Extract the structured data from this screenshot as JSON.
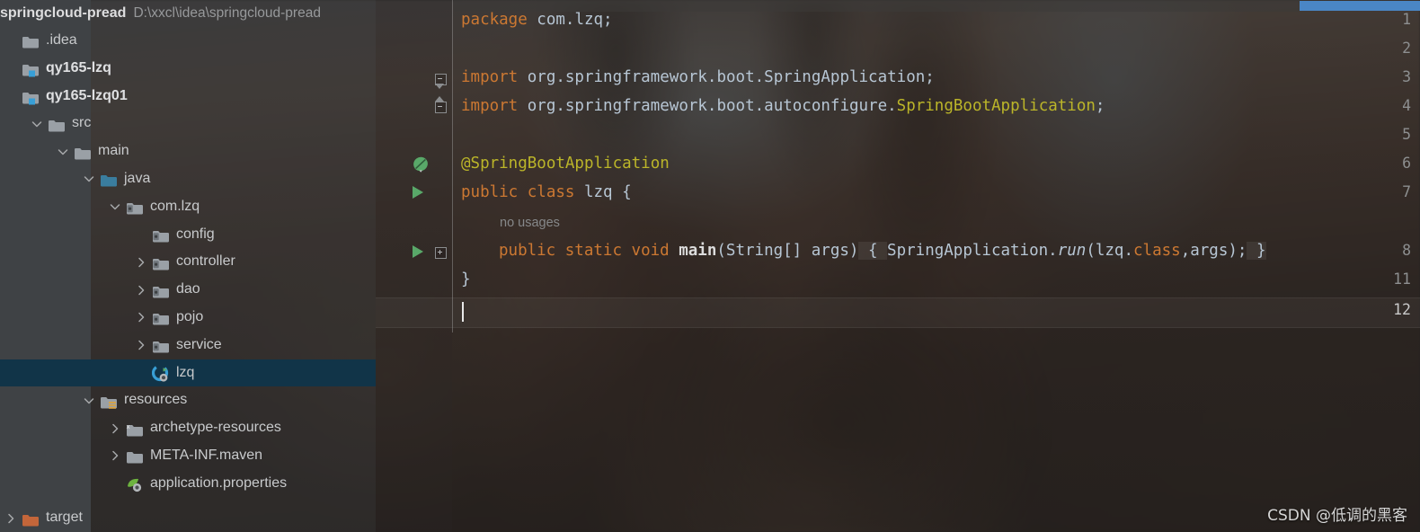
{
  "project": {
    "name": "springcloud-pread",
    "path": "D:\\xxcl\\idea\\springcloud-pread"
  },
  "tree": {
    "items": [
      {
        "label": ".idea",
        "icon": "folder-icon",
        "indent": 0,
        "arrow": "none",
        "bold": false,
        "selected": false
      },
      {
        "label": "qy165-lzq",
        "icon": "module-folder-icon",
        "indent": 0,
        "arrow": "none",
        "bold": true,
        "selected": false
      },
      {
        "label": "qy165-lzq01",
        "icon": "module-folder-icon",
        "indent": 0,
        "arrow": "none",
        "bold": true,
        "selected": false
      },
      {
        "label": "src",
        "icon": "folder-icon",
        "indent": 1,
        "arrow": "expanded",
        "bold": false,
        "selected": false
      },
      {
        "label": "main",
        "icon": "folder-icon",
        "indent": 2,
        "arrow": "expanded",
        "bold": false,
        "selected": false
      },
      {
        "label": "java",
        "icon": "source-root-folder-icon",
        "indent": 3,
        "arrow": "expanded",
        "bold": false,
        "selected": false
      },
      {
        "label": "com.lzq",
        "icon": "package-icon",
        "indent": 4,
        "arrow": "expanded",
        "bold": false,
        "selected": false
      },
      {
        "label": "config",
        "icon": "package-icon",
        "indent": 5,
        "arrow": "none",
        "bold": false,
        "selected": false
      },
      {
        "label": "controller",
        "icon": "package-icon",
        "indent": 5,
        "arrow": "collapsed",
        "bold": false,
        "selected": false
      },
      {
        "label": "dao",
        "icon": "package-icon",
        "indent": 5,
        "arrow": "collapsed",
        "bold": false,
        "selected": false
      },
      {
        "label": "pojo",
        "icon": "package-icon",
        "indent": 5,
        "arrow": "collapsed",
        "bold": false,
        "selected": false
      },
      {
        "label": "service",
        "icon": "package-icon",
        "indent": 5,
        "arrow": "collapsed",
        "bold": false,
        "selected": false
      },
      {
        "label": "lzq",
        "icon": "spring-class-icon",
        "indent": 5,
        "arrow": "none",
        "bold": false,
        "selected": true
      },
      {
        "label": "resources",
        "icon": "resource-root-folder-icon",
        "indent": 3,
        "arrow": "expanded",
        "bold": false,
        "selected": false
      },
      {
        "label": "archetype-resources",
        "icon": "excluded-folder-icon",
        "indent": 4,
        "arrow": "collapsed",
        "bold": false,
        "selected": false
      },
      {
        "label": "META-INF.maven",
        "icon": "folder-icon",
        "indent": 4,
        "arrow": "collapsed",
        "bold": false,
        "selected": false
      },
      {
        "label": "application.properties",
        "icon": "spring-properties-icon",
        "indent": 4,
        "arrow": "none",
        "bold": false,
        "selected": false
      },
      {
        "label": "target",
        "icon": "orange-folder-icon",
        "indent": 0,
        "arrow": "collapsed",
        "bold": false,
        "selected": false
      }
    ]
  },
  "editor": {
    "line_numbers": [
      "1",
      "2",
      "3",
      "4",
      "5",
      "6",
      "7",
      "8",
      "11",
      "12"
    ],
    "current_line": "12",
    "gutter_markers": [
      {
        "line": "6",
        "icon": "spring-bean-leaf-icon"
      },
      {
        "line": "7",
        "icon": "run-class-icon"
      },
      {
        "line": "8",
        "icon": "run-method-icon"
      }
    ],
    "inlay_hint": "no usages",
    "code": {
      "l1_kw": "package",
      "l1_rest": " com.lzq;",
      "l3_kw": "import",
      "l3_rest": " org.springframework.boot.SpringApplication;",
      "l4_kw": "import",
      "l4_pkg": " org.springframework.boot.autoconfigure.",
      "l4_cls": "SpringBootApplication",
      "l4_end": ";",
      "l6_anno": "@SpringBootApplication",
      "l7_kw1": "public",
      "l7_kw2": "class",
      "l7_name": " lzq ",
      "l7_brace": "{",
      "l8_kw1": "public",
      "l8_kw2": "static",
      "l8_kw3": "void",
      "l8_mth": "main",
      "l8_args": "(String[] args)",
      "l8_open": " { ",
      "l8_call": "SpringApplication.",
      "l8_run": "run",
      "l8_arg1": "(lzq.",
      "l8_class_kw": "class",
      "l8_arg2": ",args);",
      "l8_close": " }",
      "l11_brace": "}"
    }
  },
  "watermark": {
    "text": "CSDN @低调的黑客"
  },
  "colors": {
    "accent_blue": "#4a86c5",
    "selection_navy": "#113448",
    "keyword_orange": "#cc7832",
    "annotation_yellow": "#bbb529",
    "run_green": "#59a869",
    "source_root_blue": "#3a7d9e",
    "target_orange": "#c4663a"
  }
}
